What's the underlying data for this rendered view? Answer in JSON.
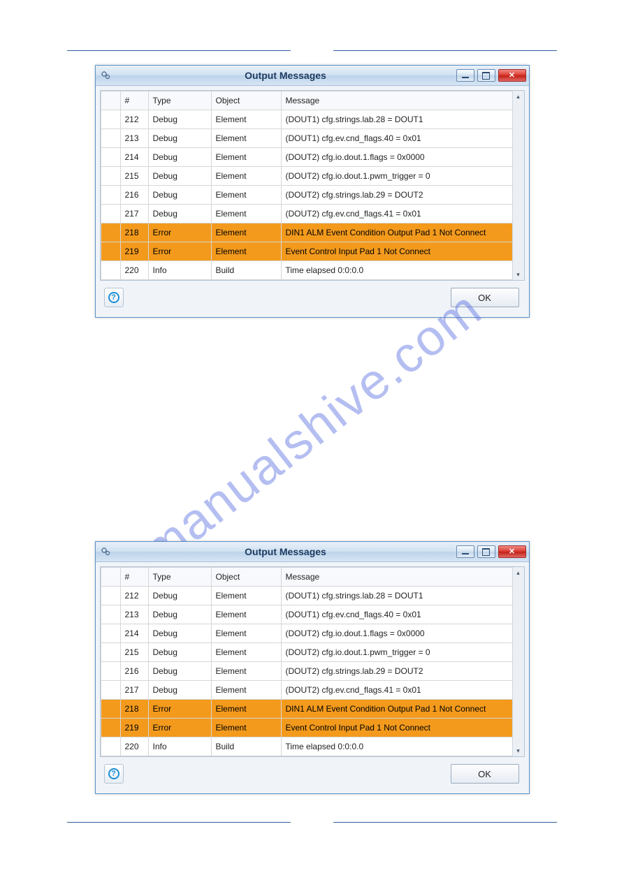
{
  "watermark": "manualshive.com",
  "dialogs": [
    {
      "title": "Output Messages",
      "help_label": "?",
      "ok_label": "OK",
      "columns": {
        "blank": "",
        "num": "#",
        "type": "Type",
        "object": "Object",
        "message": "Message"
      },
      "rows": [
        {
          "num": "212",
          "type": "Debug",
          "object": "Element",
          "message": "(DOUT1) cfg.strings.lab.28 = DOUT1",
          "level": "Debug"
        },
        {
          "num": "213",
          "type": "Debug",
          "object": "Element",
          "message": "(DOUT1) cfg.ev.cnd_flags.40 = 0x01",
          "level": "Debug"
        },
        {
          "num": "214",
          "type": "Debug",
          "object": "Element",
          "message": "(DOUT2) cfg.io.dout.1.flags = 0x0000",
          "level": "Debug"
        },
        {
          "num": "215",
          "type": "Debug",
          "object": "Element",
          "message": "(DOUT2) cfg.io.dout.1.pwm_trigger = 0",
          "level": "Debug"
        },
        {
          "num": "216",
          "type": "Debug",
          "object": "Element",
          "message": "(DOUT2) cfg.strings.lab.29 = DOUT2",
          "level": "Debug"
        },
        {
          "num": "217",
          "type": "Debug",
          "object": "Element",
          "message": "(DOUT2) cfg.ev.cnd_flags.41 = 0x01",
          "level": "Debug"
        },
        {
          "num": "218",
          "type": "Error",
          "object": "Element",
          "message": "DIN1 ALM Event Condition Output Pad 1 Not Connect",
          "level": "Error"
        },
        {
          "num": "219",
          "type": "Error",
          "object": "Element",
          "message": "Event Control Input Pad 1 Not Connect",
          "level": "Error"
        },
        {
          "num": "220",
          "type": "Info",
          "object": "Build",
          "message": "Time elapsed 0:0:0.0",
          "level": "Info"
        }
      ]
    },
    {
      "title": "Output Messages",
      "help_label": "?",
      "ok_label": "OK",
      "columns": {
        "blank": "",
        "num": "#",
        "type": "Type",
        "object": "Object",
        "message": "Message"
      },
      "rows": [
        {
          "num": "212",
          "type": "Debug",
          "object": "Element",
          "message": "(DOUT1) cfg.strings.lab.28 = DOUT1",
          "level": "Debug"
        },
        {
          "num": "213",
          "type": "Debug",
          "object": "Element",
          "message": "(DOUT1) cfg.ev.cnd_flags.40 = 0x01",
          "level": "Debug"
        },
        {
          "num": "214",
          "type": "Debug",
          "object": "Element",
          "message": "(DOUT2) cfg.io.dout.1.flags = 0x0000",
          "level": "Debug"
        },
        {
          "num": "215",
          "type": "Debug",
          "object": "Element",
          "message": "(DOUT2) cfg.io.dout.1.pwm_trigger = 0",
          "level": "Debug"
        },
        {
          "num": "216",
          "type": "Debug",
          "object": "Element",
          "message": "(DOUT2) cfg.strings.lab.29 = DOUT2",
          "level": "Debug"
        },
        {
          "num": "217",
          "type": "Debug",
          "object": "Element",
          "message": "(DOUT2) cfg.ev.cnd_flags.41 = 0x01",
          "level": "Debug"
        },
        {
          "num": "218",
          "type": "Error",
          "object": "Element",
          "message": "DIN1 ALM Event Condition Output Pad 1 Not Connect",
          "level": "Error"
        },
        {
          "num": "219",
          "type": "Error",
          "object": "Element",
          "message": "Event Control Input Pad 1 Not Connect",
          "level": "Error"
        },
        {
          "num": "220",
          "type": "Info",
          "object": "Build",
          "message": "Time elapsed 0:0:0.0",
          "level": "Info"
        }
      ]
    }
  ]
}
